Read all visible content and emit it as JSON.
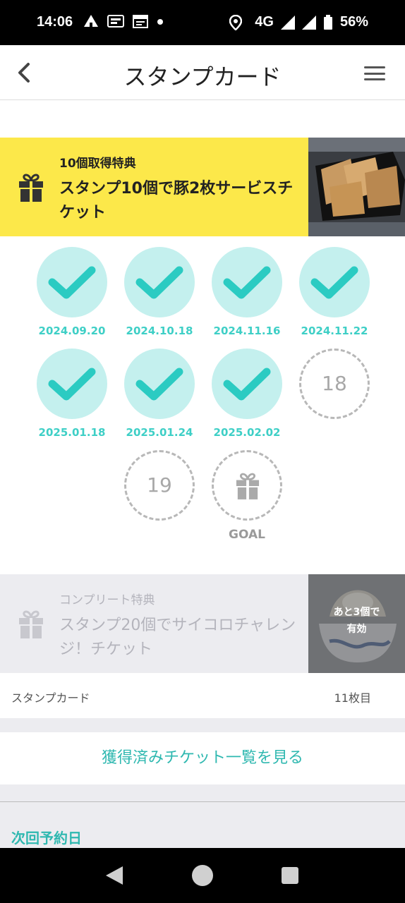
{
  "status_bar": {
    "time": "14:06",
    "left_icons": [
      "tent-icon",
      "manga-up-icon",
      "calendar-icon",
      "dot-icon"
    ],
    "network": "4G",
    "battery": "56%"
  },
  "header": {
    "title": "スタンプカード",
    "back_icon": "chevron-left-icon",
    "menu_icon": "hamburger-menu-icon"
  },
  "reward_10": {
    "small_label": "10個取得特典",
    "main_label": "スタンプ10個で豚2枚サービスチケット",
    "icon": "gift-icon"
  },
  "stamps": [
    {
      "state": "done",
      "date": "2024.09.20"
    },
    {
      "state": "done",
      "date": "2024.10.18"
    },
    {
      "state": "done",
      "date": "2024.11.16"
    },
    {
      "state": "done",
      "date": "2024.11.22"
    },
    {
      "state": "done",
      "date": "2025.01.18"
    },
    {
      "state": "done",
      "date": "2025.01.24"
    },
    {
      "state": "done",
      "date": "2025.02.02"
    },
    {
      "state": "empty",
      "number": "18"
    },
    {
      "state": "empty",
      "number": "19"
    },
    {
      "state": "goal",
      "label": "GOAL"
    }
  ],
  "reward_complete": {
    "small_label": "コンプリート特典",
    "main_label": "スタンプ20個でサイコロチャレンジ！チケット",
    "badge_line1": "あと3個で",
    "badge_line2": "有効",
    "icon": "gift-icon"
  },
  "card_footer": {
    "label": "スタンプカード",
    "count": "11枚目"
  },
  "tickets_button": "獲得済みチケット一覧を見る",
  "next_reservation_label": "次回予約日",
  "colors": {
    "accent": "#3ecfc6",
    "yellow": "#fce84a",
    "stamp_fill": "#c4f0ee"
  }
}
